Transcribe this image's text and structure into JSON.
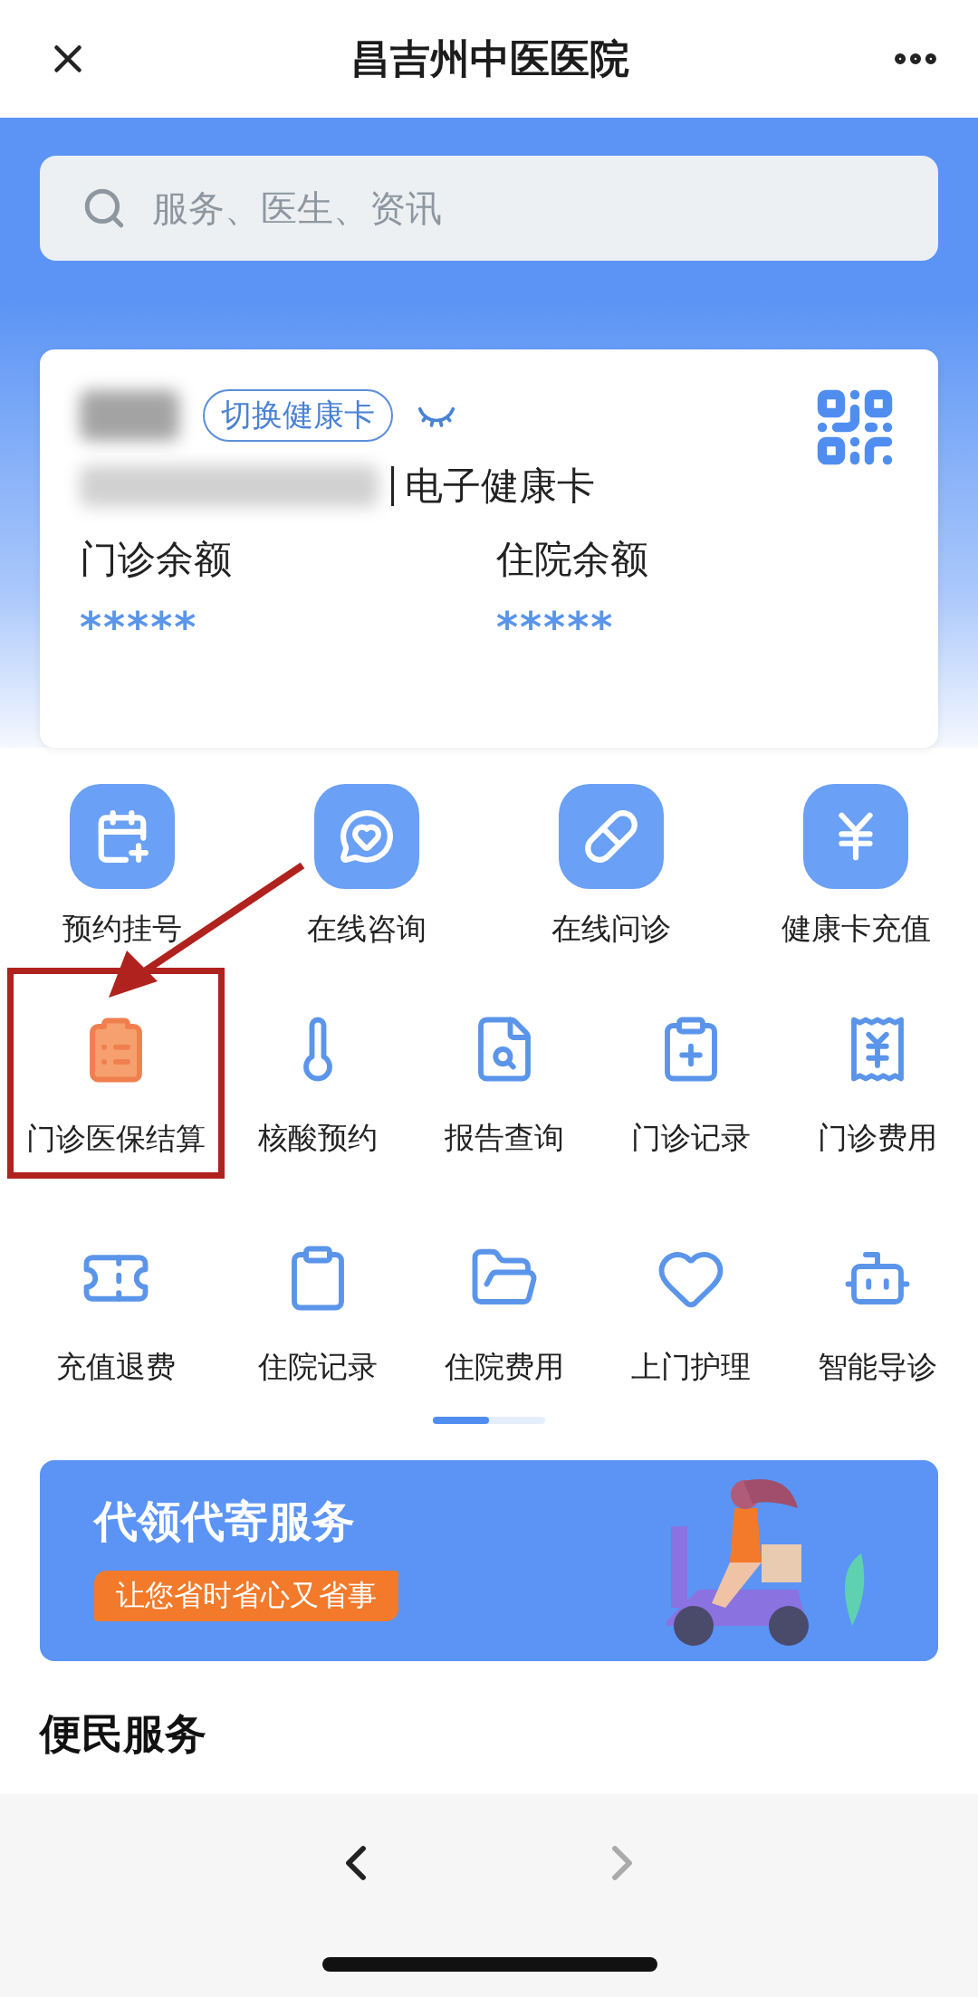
{
  "nav": {
    "title": "昌吉州中医医院"
  },
  "search": {
    "placeholder": "服务、医生、资讯"
  },
  "card": {
    "switch_label": "切换健康卡",
    "card_type": "电子健康卡",
    "balances": [
      {
        "label": "门诊余额",
        "value": "*****"
      },
      {
        "label": "住院余额",
        "value": "*****"
      }
    ]
  },
  "main_services": [
    {
      "label": "预约挂号"
    },
    {
      "label": "在线咨询"
    },
    {
      "label": "在线问诊"
    },
    {
      "label": "健康卡充值"
    }
  ],
  "services": [
    {
      "label": "门诊医保结算",
      "highlighted": true
    },
    {
      "label": "核酸预约",
      "highlighted": false
    },
    {
      "label": "报告查询",
      "highlighted": false
    },
    {
      "label": "门诊记录",
      "highlighted": false
    },
    {
      "label": "门诊费用",
      "highlighted": false
    },
    {
      "label": "充值退费",
      "highlighted": false
    },
    {
      "label": "住院记录",
      "highlighted": false
    },
    {
      "label": "住院费用",
      "highlighted": false
    },
    {
      "label": "上门护理",
      "highlighted": false
    },
    {
      "label": "智能导诊",
      "highlighted": false
    }
  ],
  "banner": {
    "title": "代领代寄服务",
    "subtitle": "让您省时省心又省事"
  },
  "section_heading": "便民服务"
}
